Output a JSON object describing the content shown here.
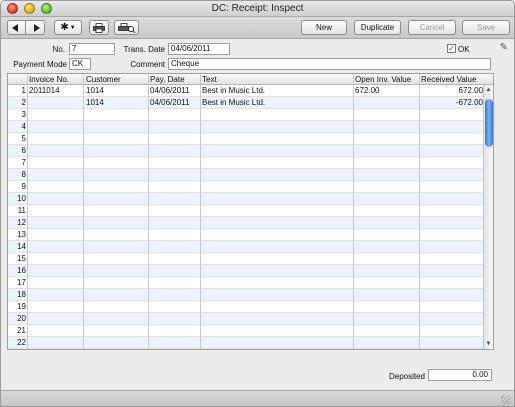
{
  "window": {
    "title": "DC: Receipt: Inspect"
  },
  "toolbar": {
    "new_label": "New",
    "duplicate_label": "Duplicate",
    "cancel_label": "Cancel",
    "save_label": "Save"
  },
  "header": {
    "no_label": "No.",
    "no_value": "7",
    "trans_date_label": "Trans. Date",
    "trans_date_value": "04/06/2011",
    "ok_label": "OK",
    "ok_checked": true,
    "payment_mode_label": "Payment Mode",
    "payment_mode_value": "CK",
    "comment_label": "Comment",
    "comment_value": "Cheque"
  },
  "grid": {
    "columns": [
      "Invoice No.",
      "Customer",
      "Pay. Date",
      "Text",
      "Open Inv. Value",
      "Received Value"
    ],
    "rows": [
      {
        "num": "1",
        "invoice": "2011014",
        "customer": "1014",
        "pay_date": "04/06/2011",
        "text": "Best in Music Ltd.",
        "open": "672.00",
        "received": "672.00"
      },
      {
        "num": "2",
        "invoice": "",
        "customer": "1014",
        "pay_date": "04/06/2011",
        "text": "Best in Music Ltd.",
        "open": "",
        "received": "-672.00"
      },
      {
        "num": "3"
      },
      {
        "num": "4"
      },
      {
        "num": "5"
      },
      {
        "num": "6"
      },
      {
        "num": "7"
      },
      {
        "num": "8"
      },
      {
        "num": "9"
      },
      {
        "num": "10"
      },
      {
        "num": "11"
      },
      {
        "num": "12"
      },
      {
        "num": "13"
      },
      {
        "num": "14"
      },
      {
        "num": "15"
      },
      {
        "num": "16"
      },
      {
        "num": "17"
      },
      {
        "num": "18"
      },
      {
        "num": "19"
      },
      {
        "num": "20"
      },
      {
        "num": "21"
      },
      {
        "num": "22"
      }
    ]
  },
  "footer": {
    "deposited_label": "Deposited",
    "deposited_value": "0.00"
  },
  "icons": {
    "prev": "left-arrow-icon",
    "next": "right-arrow-icon",
    "operations": "gear-icon",
    "print": "printer-icon",
    "print_preview": "print-preview-icon",
    "pin": "pin-icon"
  }
}
